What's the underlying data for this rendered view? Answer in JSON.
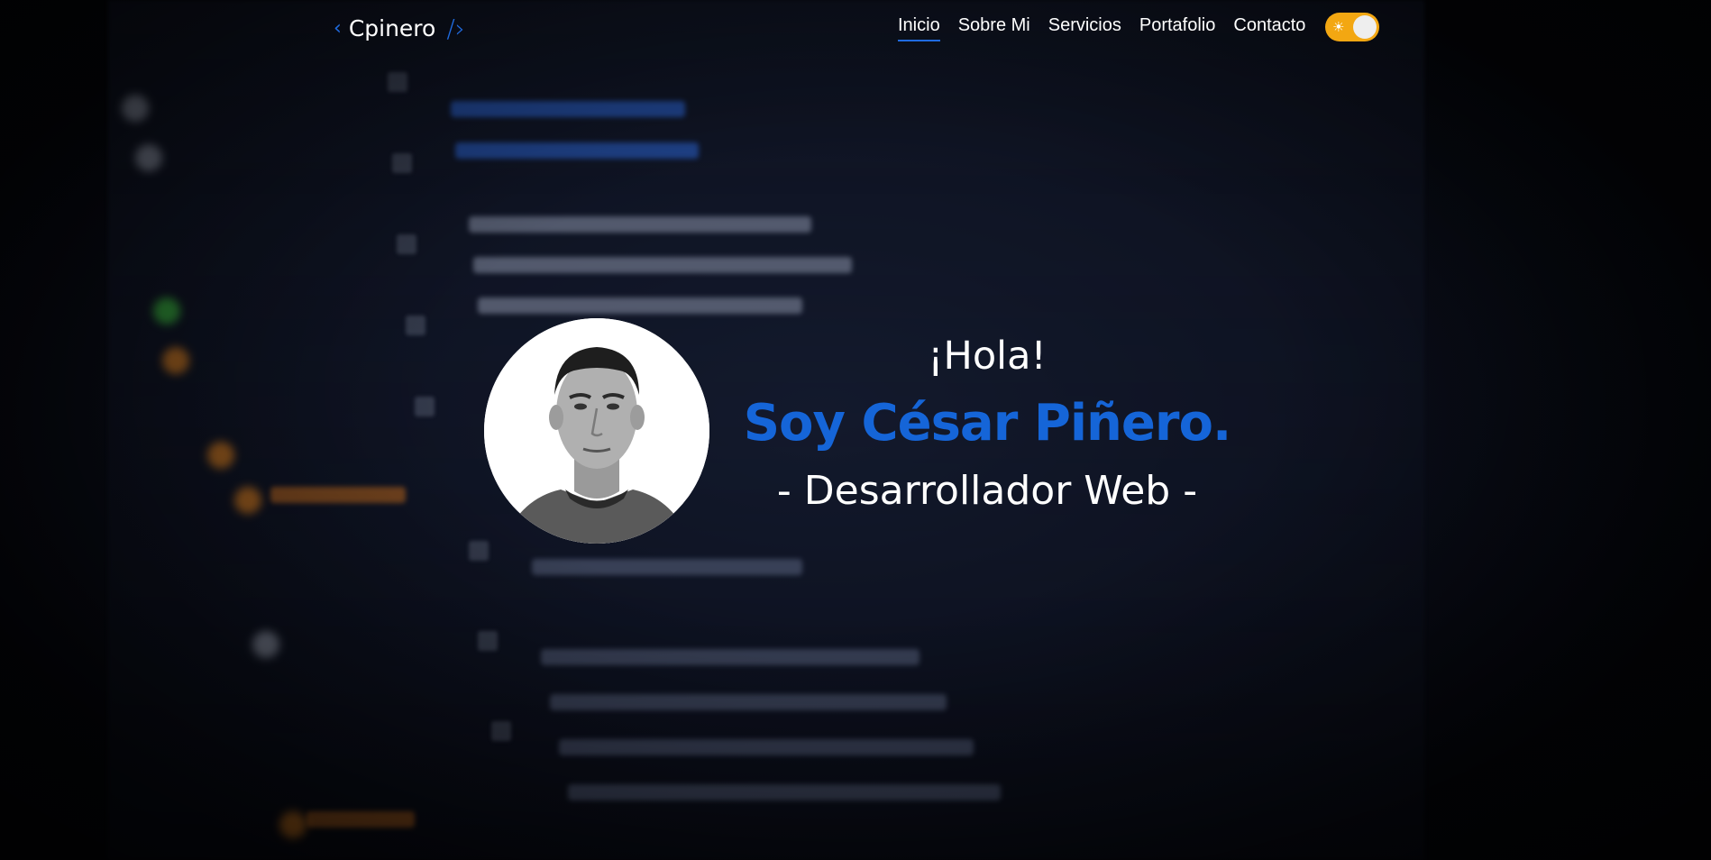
{
  "brand": {
    "left_icon": "chevron-left-icon",
    "name": "Cpinero",
    "right_icon": "chevron-right-slash-icon",
    "accent_color": "#1f6be0"
  },
  "nav": {
    "items": [
      {
        "label": "Inicio",
        "active": true
      },
      {
        "label": "Sobre Mi",
        "active": false
      },
      {
        "label": "Servicios",
        "active": false
      },
      {
        "label": "Portafolio",
        "active": false
      },
      {
        "label": "Contacto",
        "active": false
      }
    ]
  },
  "theme_toggle": {
    "icon": "sun-icon",
    "track_color": "#f3a712",
    "state": "light"
  },
  "hero": {
    "greeting": "¡Hola!",
    "name": "Soy César Piñero.",
    "role": "- Desarrollador Web -",
    "name_color": "#1565d8",
    "avatar": "profile-photo"
  }
}
